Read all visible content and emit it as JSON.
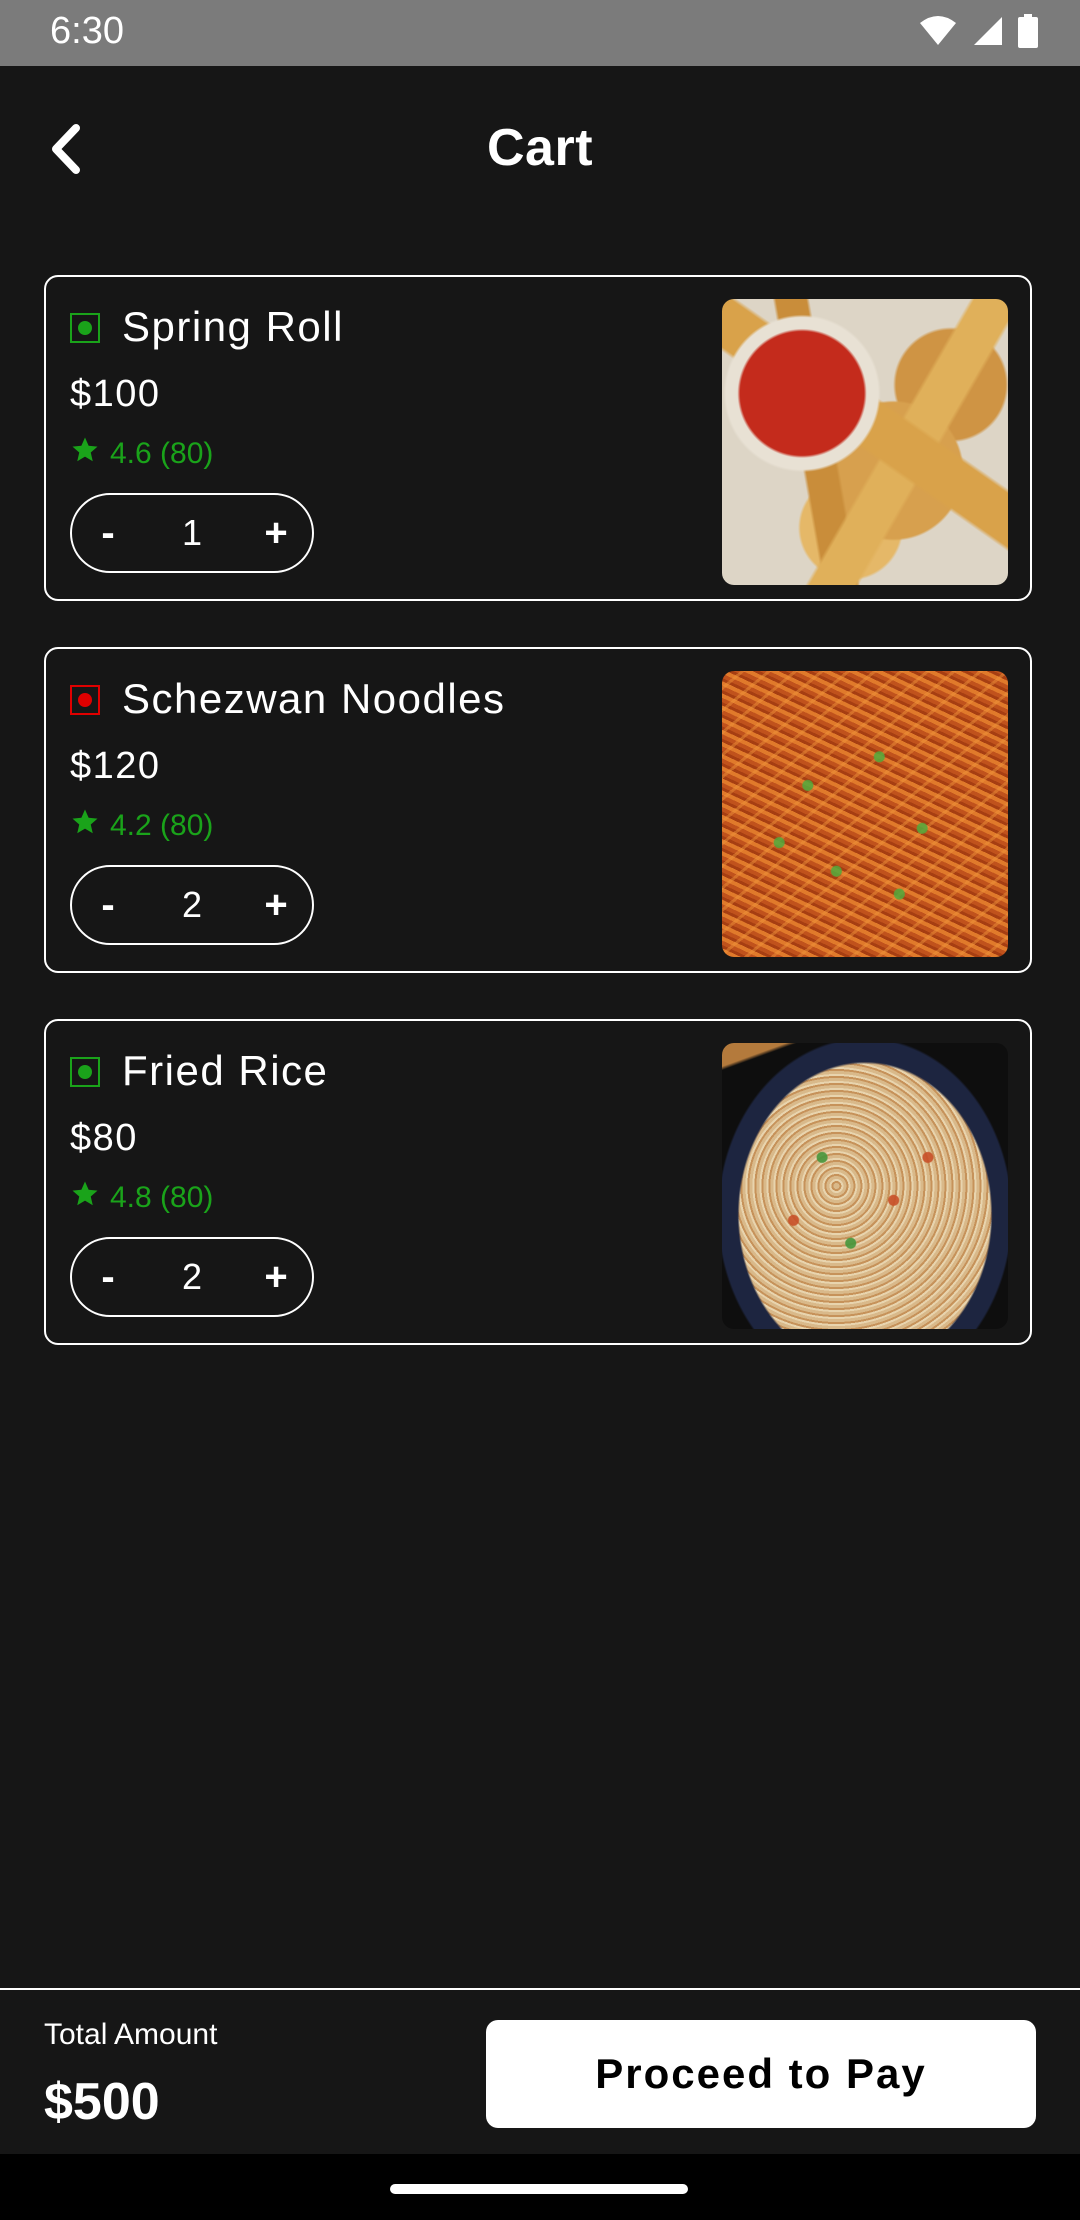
{
  "status_bar": {
    "time": "6:30",
    "icons": [
      "wifi-icon",
      "signal-icon",
      "battery-icon"
    ]
  },
  "header": {
    "title": "Cart",
    "back_icon": "chevron-left-icon"
  },
  "colors": {
    "background": "#161616",
    "veg": "#1aa31a",
    "non_veg": "#e00000",
    "rating": "#1aa31a",
    "button_bg": "#ffffff",
    "button_text": "#000000"
  },
  "items": [
    {
      "name": "Spring Roll",
      "price": "$100",
      "rating": "4.6 (80)",
      "quantity": "1",
      "minus_label": "-",
      "plus_label": "+",
      "veg": true,
      "image": "spring-roll-image"
    },
    {
      "name": "Schezwan Noodles",
      "price": "$120",
      "rating": "4.2 (80)",
      "quantity": "2",
      "minus_label": "-",
      "plus_label": "+",
      "veg": false,
      "image": "schezwan-noodles-image"
    },
    {
      "name": "Fried Rice",
      "price": "$80",
      "rating": "4.8 (80)",
      "quantity": "2",
      "minus_label": "-",
      "plus_label": "+",
      "veg": true,
      "image": "fried-rice-image"
    }
  ],
  "footer": {
    "total_label": "Total Amount",
    "total_value": "$500",
    "pay_button_label": "Proceed to Pay"
  }
}
